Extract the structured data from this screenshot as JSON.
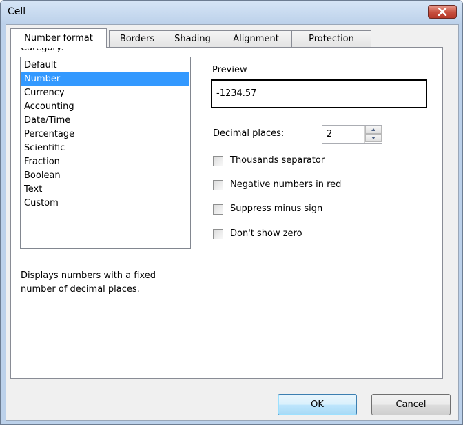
{
  "window": {
    "title": "Cell",
    "close_icon": "close-icon"
  },
  "tabs": [
    {
      "label": "Number format",
      "active": true
    },
    {
      "label": "Borders",
      "active": false
    },
    {
      "label": "Shading",
      "active": false
    },
    {
      "label": "Alignment",
      "active": false
    },
    {
      "label": "Protection",
      "active": false
    }
  ],
  "category": {
    "label": "Category:",
    "items": [
      "Default",
      "Number",
      "Currency",
      "Accounting",
      "Date/Time",
      "Percentage",
      "Scientific",
      "Fraction",
      "Boolean",
      "Text",
      "Custom"
    ],
    "selected": "Number",
    "description": [
      "Displays numbers with a fixed",
      "number of decimal places."
    ]
  },
  "preview": {
    "label": "Preview",
    "value": "-1234.57"
  },
  "decimal_places": {
    "label": "Decimal places:",
    "value": "2"
  },
  "options": [
    {
      "label": "Thousands separator",
      "checked": false
    },
    {
      "label": "Negative numbers in red",
      "checked": false
    },
    {
      "label": "Suppress minus sign",
      "checked": false
    },
    {
      "label": "Don't show zero",
      "checked": false
    }
  ],
  "buttons": {
    "ok": "OK",
    "cancel": "Cancel"
  },
  "colors": {
    "selection": "#3399ff",
    "titlebar": "#bcd1ea",
    "close": "#c7503f"
  }
}
